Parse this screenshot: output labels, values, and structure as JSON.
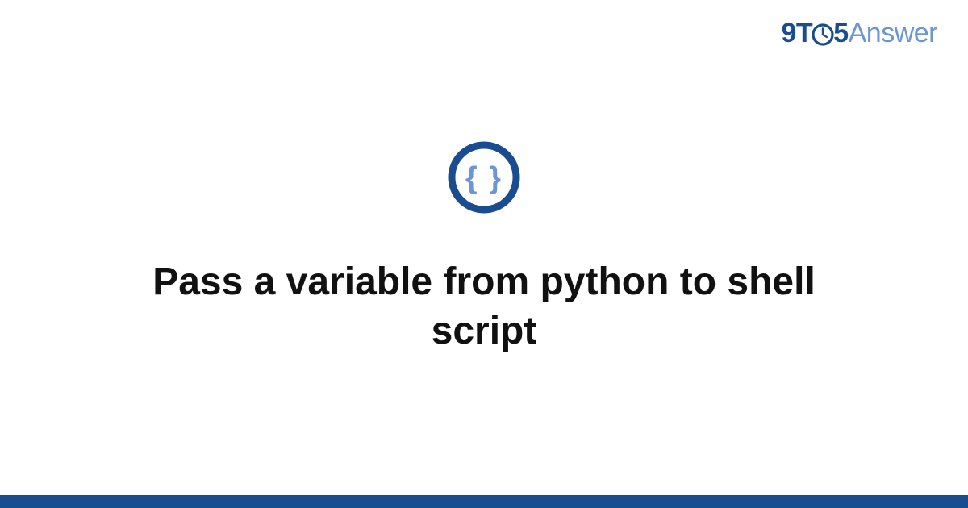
{
  "site": {
    "logo_parts": {
      "nine_t": "9T",
      "five": "5",
      "answer": "Answer"
    }
  },
  "main": {
    "question_title": "Pass a variable from python to shell script"
  }
}
